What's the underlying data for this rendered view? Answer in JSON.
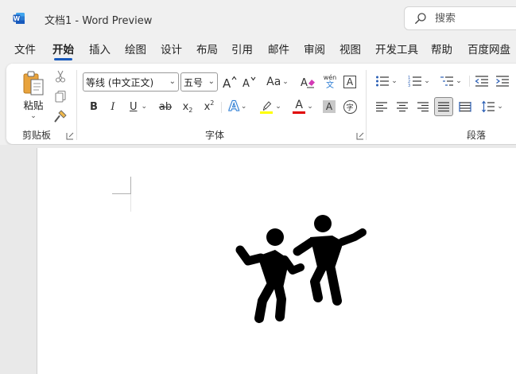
{
  "app": {
    "title": "文档1  -  Word Preview",
    "search_placeholder": "搜索"
  },
  "menu": {
    "tabs": [
      {
        "label": "文件"
      },
      {
        "label": "开始"
      },
      {
        "label": "插入"
      },
      {
        "label": "绘图"
      },
      {
        "label": "设计"
      },
      {
        "label": "布局"
      },
      {
        "label": "引用"
      },
      {
        "label": "邮件"
      },
      {
        "label": "审阅"
      },
      {
        "label": "视图"
      },
      {
        "label": "开发工具"
      },
      {
        "label": "帮助"
      },
      {
        "label": "百度网盘"
      }
    ],
    "active_tab": "开始"
  },
  "ribbon": {
    "clipboard": {
      "paste_label": "粘贴",
      "group_label": "剪贴板"
    },
    "font": {
      "font_name": "等线 (中文正文)",
      "font_size": "五号",
      "change_case_label": "Aa",
      "phonetic_top": "wén",
      "phonetic_bottom": "文",
      "char_border_label": "A",
      "bold_label": "B",
      "italic_label": "I",
      "underline_label": "U",
      "strike_label": "ab",
      "subscript_label": "x",
      "subscript_mark": "2",
      "superscript_label": "x",
      "superscript_mark": "2",
      "text_effect_label": "A",
      "font_color_label": "A",
      "char_shading_label": "A",
      "enclose_label": "字",
      "group_label": "字体",
      "highlight_color": "#ffff00",
      "font_color": "#e00000"
    },
    "paragraph": {
      "group_label": "段落"
    }
  },
  "colors": {
    "accent": "#185abd",
    "app_icon": "#185abd"
  }
}
